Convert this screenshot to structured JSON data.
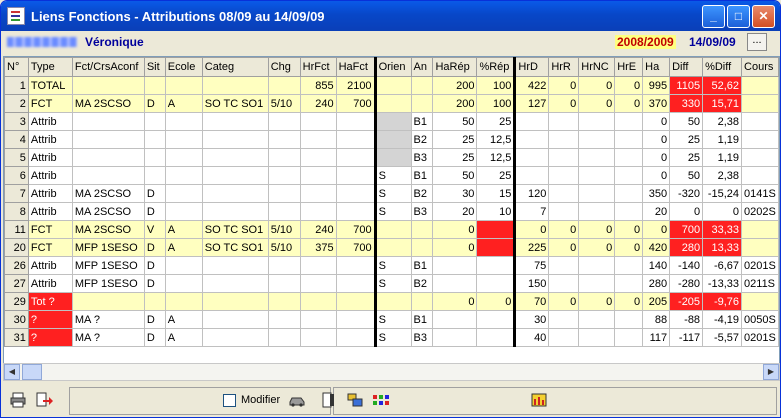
{
  "window": {
    "title": "Liens Fonctions - Attributions 08/09 au 14/09/09",
    "min": "_",
    "max": "□",
    "close": "✕"
  },
  "info": {
    "person_first": "Véronique",
    "year": "2008/2009",
    "date": "14/09/09",
    "more": "..."
  },
  "columns": [
    "N°",
    "Type",
    "Fct/CrsAconf",
    "Sit",
    "Ecole",
    "Categ",
    "Chg",
    "HrFct",
    "HaFct",
    "Orien",
    "An",
    "HaRép",
    "%Rép",
    "HrD",
    "HrR",
    "HrNC",
    "HrE",
    "Ha",
    "Diff",
    "%Diff",
    "Cours"
  ],
  "rows": [
    {
      "c": [
        "1",
        "TOTAL",
        "",
        "",
        "",
        "",
        "",
        "855",
        "2100",
        "",
        "",
        "200",
        "100",
        "422",
        "0",
        "0",
        "0",
        "995",
        "1105",
        "52,62",
        ""
      ],
      "y": true,
      "red": [
        18,
        19
      ]
    },
    {
      "c": [
        "2",
        "FCT",
        "MA 2SCSO",
        "D",
        "A",
        "SO TC SO1",
        "5/10",
        "240",
        "700",
        "",
        "",
        "200",
        "100",
        "127",
        "0",
        "0",
        "0",
        "370",
        "330",
        "15,71",
        ""
      ],
      "y": true,
      "red": [
        18,
        19
      ]
    },
    {
      "c": [
        "3",
        "Attrib",
        "",
        "",
        "",
        "",
        "",
        "",
        "",
        "",
        "B1",
        "50",
        "25",
        "",
        "",
        "",
        "",
        "0",
        "50",
        "2,38",
        ""
      ],
      "gray": [
        9
      ]
    },
    {
      "c": [
        "4",
        "Attrib",
        "",
        "",
        "",
        "",
        "",
        "",
        "",
        "",
        "B2",
        "25",
        "12,5",
        "",
        "",
        "",
        "",
        "0",
        "25",
        "1,19",
        ""
      ],
      "gray": [
        9
      ]
    },
    {
      "c": [
        "5",
        "Attrib",
        "",
        "",
        "",
        "",
        "",
        "",
        "",
        "",
        "B3",
        "25",
        "12,5",
        "",
        "",
        "",
        "",
        "0",
        "25",
        "1,19",
        ""
      ],
      "gray": [
        9
      ]
    },
    {
      "c": [
        "6",
        "Attrib",
        "",
        "",
        "",
        "",
        "",
        "",
        "",
        "S",
        "B1",
        "50",
        "25",
        "",
        "",
        "",
        "",
        "0",
        "50",
        "2,38",
        ""
      ]
    },
    {
      "c": [
        "7",
        "Attrib",
        "MA 2SCSO",
        "D",
        "",
        "",
        "",
        "",
        "",
        "S",
        "B2",
        "30",
        "15",
        "120",
        "",
        "",
        "",
        "350",
        "-320",
        "-15,24",
        "0141S"
      ]
    },
    {
      "c": [
        "8",
        "Attrib",
        "MA 2SCSO",
        "D",
        "",
        "",
        "",
        "",
        "",
        "S",
        "B3",
        "20",
        "10",
        "7",
        "",
        "",
        "",
        "20",
        "0",
        "0",
        "0202S"
      ]
    },
    {
      "c": [
        "11",
        "FCT",
        "MA 2SCSO",
        "V",
        "A",
        "SO TC SO1",
        "5/10",
        "240",
        "700",
        "",
        "",
        "0",
        "",
        "0",
        "0",
        "0",
        "0",
        "0",
        "700",
        "33,33",
        ""
      ],
      "y": true,
      "red": [
        12,
        18,
        19
      ]
    },
    {
      "c": [
        "20",
        "FCT",
        "MFP 1SESO",
        "D",
        "A",
        "SO TC SO1",
        "5/10",
        "375",
        "700",
        "",
        "",
        "0",
        "",
        "225",
        "0",
        "0",
        "0",
        "420",
        "280",
        "13,33",
        ""
      ],
      "y": true,
      "red": [
        12,
        18,
        19
      ]
    },
    {
      "c": [
        "26",
        "Attrib",
        "MFP 1SESO",
        "D",
        "",
        "",
        "",
        "",
        "",
        "S",
        "B1",
        "",
        "",
        "75",
        "",
        "",
        "",
        "140",
        "-140",
        "-6,67",
        "0201S"
      ]
    },
    {
      "c": [
        "27",
        "Attrib",
        "MFP 1SESO",
        "D",
        "",
        "",
        "",
        "",
        "",
        "S",
        "B2",
        "",
        "",
        "150",
        "",
        "",
        "",
        "280",
        "-280",
        "-13,33",
        "0211S"
      ]
    },
    {
      "c": [
        "29",
        "Tot ?",
        "",
        "",
        "",
        "",
        "",
        "",
        "",
        "",
        "",
        "0",
        "0",
        "70",
        "0",
        "0",
        "0",
        "205",
        "-205",
        "-9,76",
        ""
      ],
      "y": true,
      "red": [
        1,
        18,
        19
      ]
    },
    {
      "c": [
        "30",
        "?",
        "MA ?",
        "D",
        "A",
        "",
        "",
        "",
        "",
        "S",
        "B1",
        "",
        "",
        "30",
        "",
        "",
        "",
        "88",
        "-88",
        "-4,19",
        "0050S"
      ],
      "red": [
        1
      ]
    },
    {
      "c": [
        "31",
        "?",
        "MA ?",
        "D",
        "A",
        "",
        "",
        "",
        "",
        "S",
        "B3",
        "",
        "",
        "40",
        "",
        "",
        "",
        "117",
        "-117",
        "-5,57",
        "0201S"
      ],
      "red": [
        1
      ]
    }
  ],
  "toolbar": {
    "modifier": "Modifier"
  }
}
